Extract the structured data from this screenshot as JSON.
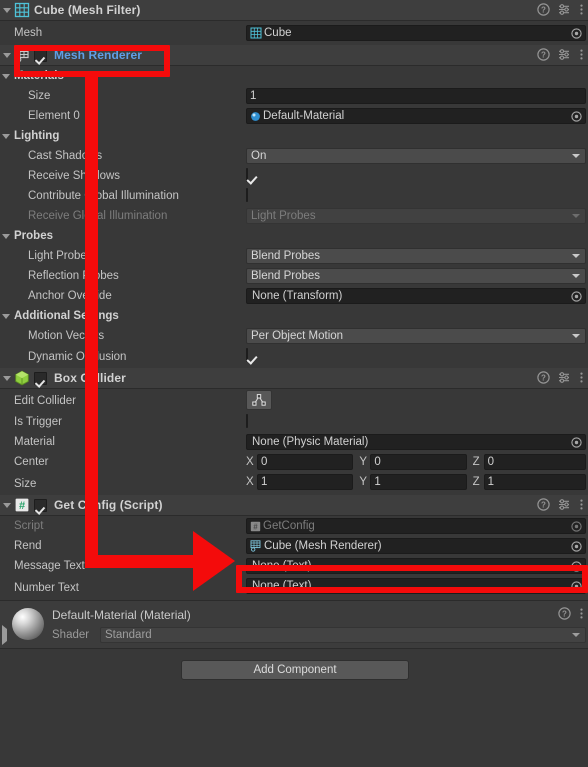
{
  "components": [
    {
      "id": "mesh-filter",
      "title": "Cube (Mesh Filter)",
      "icon": "mesh-filter-icon",
      "has_checkbox": false,
      "rows": [
        {
          "label": "Mesh",
          "type": "object",
          "value": "Cube",
          "icon": "mesh-icon"
        }
      ]
    },
    {
      "id": "mesh-renderer",
      "title": "Mesh Renderer",
      "icon": "mesh-renderer-icon",
      "has_checkbox": true,
      "checked": true,
      "highlighted": true,
      "groups": [
        {
          "label": "Materials",
          "rows": [
            {
              "label": "Size",
              "type": "text",
              "value": "1"
            },
            {
              "label": "Element 0",
              "type": "object",
              "value": "Default-Material",
              "icon": "material-icon"
            }
          ]
        },
        {
          "label": "Lighting",
          "rows": [
            {
              "label": "Cast Shadows",
              "type": "dropdown",
              "value": "On"
            },
            {
              "label": "Receive Shadows",
              "type": "checkbox",
              "checked": true
            },
            {
              "label": "Contribute Global Illumination",
              "type": "checkbox",
              "checked": false
            },
            {
              "label": "Receive Global Illumination",
              "type": "dropdown",
              "value": "Light Probes",
              "disabled": true
            }
          ]
        },
        {
          "label": "Probes",
          "rows": [
            {
              "label": "Light Probes",
              "type": "dropdown",
              "value": "Blend Probes"
            },
            {
              "label": "Reflection Probes",
              "type": "dropdown",
              "value": "Blend Probes"
            },
            {
              "label": "Anchor Override",
              "type": "object",
              "value": "None (Transform)"
            }
          ]
        },
        {
          "label": "Additional Settings",
          "rows": [
            {
              "label": "Motion Vectors",
              "type": "dropdown",
              "value": "Per Object Motion"
            },
            {
              "label": "Dynamic Occlusion",
              "type": "checkbox",
              "checked": true
            }
          ]
        }
      ]
    },
    {
      "id": "box-collider",
      "title": "Box Collider",
      "icon": "box-collider-icon",
      "has_checkbox": true,
      "checked": true,
      "rows": [
        {
          "label": "Edit Collider",
          "type": "edit-button",
          "icon": "edit-collider-icon"
        },
        {
          "label": "Is Trigger",
          "type": "checkbox",
          "checked": false
        },
        {
          "label": "Material",
          "type": "object",
          "value": "None (Physic Material)"
        },
        {
          "label": "Center",
          "type": "vector3",
          "axes": [
            "X",
            "Y",
            "Z"
          ],
          "values": [
            "0",
            "0",
            "0"
          ]
        },
        {
          "label": "Size",
          "type": "vector3",
          "axes": [
            "X",
            "Y",
            "Z"
          ],
          "values": [
            "1",
            "1",
            "1"
          ]
        }
      ]
    },
    {
      "id": "get-config-script",
      "title": "Get Config (Script)",
      "icon": "script-icon",
      "has_checkbox": true,
      "checked": true,
      "rows": [
        {
          "label": "Script",
          "type": "object",
          "value": "GetConfig",
          "disabled": true,
          "icon": "script-asset-icon"
        },
        {
          "label": "Rend",
          "type": "object",
          "value": "Cube (Mesh Renderer)",
          "icon": "mesh-renderer-icon",
          "highlighted": true
        },
        {
          "label": "Message Text",
          "type": "object",
          "value": "None (Text)"
        },
        {
          "label": "Number Text",
          "type": "object",
          "value": "None (Text)"
        }
      ]
    }
  ],
  "material_preview": {
    "title": "Default-Material (Material)",
    "shader_label": "Shader",
    "shader_value": "Standard"
  },
  "add_component": {
    "label": "Add Component"
  },
  "icons": {
    "help": "help-icon",
    "preset": "preset-icon",
    "menu": "kebab-menu-icon",
    "picker": "object-picker-icon"
  },
  "colors": {
    "background": "#383838",
    "header": "#3e3e3e",
    "field": "#212121",
    "dropdown": "#4b4b4b",
    "link": "#5f9ee6",
    "annotation": "#f40b0b",
    "script_green": "#26a269",
    "collider_green": "#8fce3f",
    "mesh_cyan": "#4fc3d9"
  }
}
